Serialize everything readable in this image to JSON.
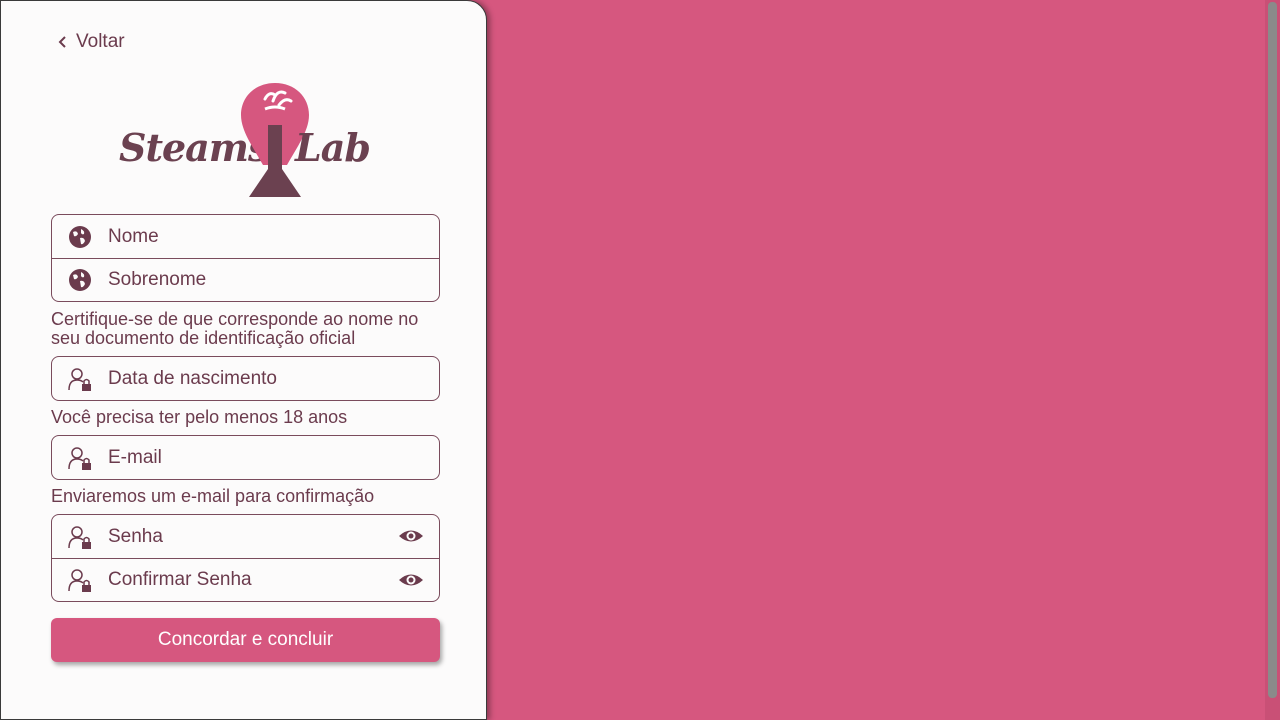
{
  "back_label": "Voltar",
  "logo": {
    "left_word": "Steams",
    "right_word": "Lab"
  },
  "name_group": {
    "first_name_placeholder": "Nome",
    "last_name_placeholder": "Sobrenome"
  },
  "name_hint": "Certifique-se de que corresponde ao nome no seu documento de identificação oficial",
  "birthdate_placeholder": "Data de nascimento",
  "birthdate_hint": "Você precisa ter pelo menos 18 anos",
  "email_placeholder": "E-mail",
  "email_hint": "Enviaremos um e-mail para confirmação",
  "password_group": {
    "password_placeholder": "Senha",
    "confirm_placeholder": "Confirmar Senha"
  },
  "submit_label": "Concordar e concluir",
  "colors": {
    "accent": "#d6577f",
    "text": "#6b3b4d",
    "panel": "#fcfbfb"
  },
  "icons": {
    "back": "chevron-left-icon",
    "globe": "globe-icon",
    "user_lock": "user-lock-icon",
    "eye": "eye-icon"
  }
}
